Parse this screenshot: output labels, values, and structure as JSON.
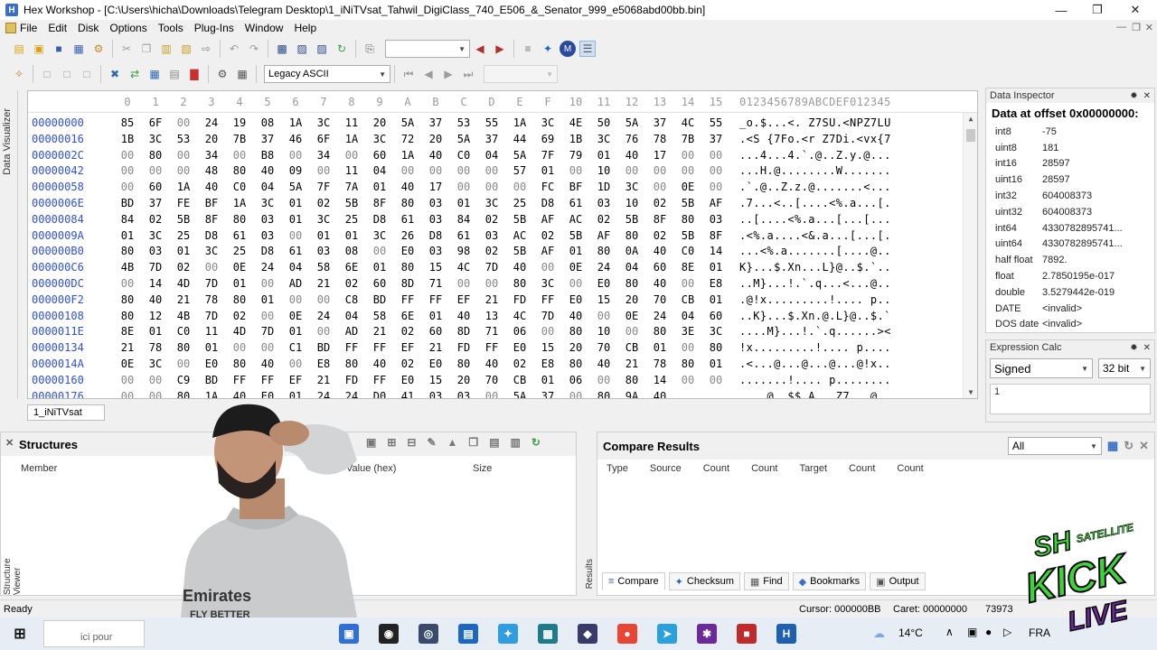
{
  "window": {
    "title": "Hex Workshop - [C:\\Users\\hicha\\Downloads\\Telegram Desktop\\1_iNiTVsat_Tahwil_DigiClass_740_E506_&_Senator_999_e5068abd00bb.bin]",
    "app_icon": "H"
  },
  "menu": [
    "File",
    "Edit",
    "Disk",
    "Options",
    "Tools",
    "Plug-Ins",
    "Window",
    "Help"
  ],
  "toolbar": {
    "encoding": "Legacy ASCII"
  },
  "editor": {
    "header_cols": [
      "0",
      "1",
      "2",
      "3",
      "4",
      "5",
      "6",
      "7",
      "8",
      "9",
      "A",
      "B",
      "C",
      "D",
      "E",
      "F",
      "10",
      "11",
      "12",
      "13",
      "14",
      "15"
    ],
    "ascii_header": "0123456789ABCDEF012345",
    "rows": [
      {
        "off": "00000000",
        "bytes": [
          "85",
          "6F",
          "00",
          "24",
          "19",
          "08",
          "1A",
          "3C",
          "11",
          "20",
          "5A",
          "37",
          "53",
          "55",
          "1A",
          "3C",
          "4E",
          "50",
          "5A",
          "37",
          "4C",
          "55"
        ],
        "ascii": "_o.$...<. Z7SU.<NPZ7LU"
      },
      {
        "off": "00000016",
        "bytes": [
          "1B",
          "3C",
          "53",
          "20",
          "7B",
          "37",
          "46",
          "6F",
          "1A",
          "3C",
          "72",
          "20",
          "5A",
          "37",
          "44",
          "69",
          "1B",
          "3C",
          "76",
          "78",
          "7B",
          "37"
        ],
        "ascii": ".<S {7Fo.<r Z7Di.<vx{7"
      },
      {
        "off": "0000002C",
        "bytes": [
          "00",
          "80",
          "00",
          "34",
          "00",
          "B8",
          "00",
          "34",
          "00",
          "60",
          "1A",
          "40",
          "C0",
          "04",
          "5A",
          "7F",
          "79",
          "01",
          "40",
          "17",
          "00",
          "00"
        ],
        "ascii": "...4...4.`.@..Z.y.@..."
      },
      {
        "off": "00000042",
        "bytes": [
          "00",
          "00",
          "00",
          "48",
          "80",
          "40",
          "09",
          "00",
          "11",
          "04",
          "00",
          "00",
          "00",
          "00",
          "57",
          "01",
          "00",
          "10",
          "00",
          "00",
          "00",
          "00"
        ],
        "ascii": "...H.@........W......."
      },
      {
        "off": "00000058",
        "bytes": [
          "00",
          "60",
          "1A",
          "40",
          "C0",
          "04",
          "5A",
          "7F",
          "7A",
          "01",
          "40",
          "17",
          "00",
          "00",
          "00",
          "FC",
          "BF",
          "1D",
          "3C",
          "00",
          "0E",
          "00"
        ],
        "ascii": ".`.@..Z.z.@.......<..."
      },
      {
        "off": "0000006E",
        "bytes": [
          "BD",
          "37",
          "FE",
          "BF",
          "1A",
          "3C",
          "01",
          "02",
          "5B",
          "8F",
          "80",
          "03",
          "01",
          "3C",
          "25",
          "D8",
          "61",
          "03",
          "10",
          "02",
          "5B",
          "AF"
        ],
        "ascii": ".7...<..[....<%.a...[."
      },
      {
        "off": "00000084",
        "bytes": [
          "84",
          "02",
          "5B",
          "8F",
          "80",
          "03",
          "01",
          "3C",
          "25",
          "D8",
          "61",
          "03",
          "84",
          "02",
          "5B",
          "AF",
          "AC",
          "02",
          "5B",
          "8F",
          "80",
          "03"
        ],
        "ascii": "..[....<%.a...[...[..."
      },
      {
        "off": "0000009A",
        "bytes": [
          "01",
          "3C",
          "25",
          "D8",
          "61",
          "03",
          "00",
          "01",
          "01",
          "3C",
          "26",
          "D8",
          "61",
          "03",
          "AC",
          "02",
          "5B",
          "AF",
          "80",
          "02",
          "5B",
          "8F"
        ],
        "ascii": ".<%.a....<&.a...[...[."
      },
      {
        "off": "000000B0",
        "bytes": [
          "80",
          "03",
          "01",
          "3C",
          "25",
          "D8",
          "61",
          "03",
          "08",
          "00",
          "E0",
          "03",
          "98",
          "02",
          "5B",
          "AF",
          "01",
          "80",
          "0A",
          "40",
          "C0",
          "14"
        ],
        "ascii": "...<%.a.......[....@.."
      },
      {
        "off": "000000C6",
        "bytes": [
          "4B",
          "7D",
          "02",
          "00",
          "0E",
          "24",
          "04",
          "58",
          "6E",
          "01",
          "80",
          "15",
          "4C",
          "7D",
          "40",
          "00",
          "0E",
          "24",
          "04",
          "60",
          "8E",
          "01"
        ],
        "ascii": "K}...$.Xn...L}@..$.`.."
      },
      {
        "off": "000000DC",
        "bytes": [
          "00",
          "14",
          "4D",
          "7D",
          "01",
          "00",
          "AD",
          "21",
          "02",
          "60",
          "8D",
          "71",
          "00",
          "00",
          "80",
          "3C",
          "00",
          "E0",
          "80",
          "40",
          "00",
          "E8"
        ],
        "ascii": "..M}...!.`.q...<...@.."
      },
      {
        "off": "000000F2",
        "bytes": [
          "80",
          "40",
          "21",
          "78",
          "80",
          "01",
          "00",
          "00",
          "C8",
          "BD",
          "FF",
          "FF",
          "EF",
          "21",
          "FD",
          "FF",
          "E0",
          "15",
          "20",
          "70",
          "CB",
          "01"
        ],
        "ascii": ".@!x.........!.... p.."
      },
      {
        "off": "00000108",
        "bytes": [
          "80",
          "12",
          "4B",
          "7D",
          "02",
          "00",
          "0E",
          "24",
          "04",
          "58",
          "6E",
          "01",
          "40",
          "13",
          "4C",
          "7D",
          "40",
          "00",
          "0E",
          "24",
          "04",
          "60"
        ],
        "ascii": "..K}...$.Xn.@.L}@..$.`"
      },
      {
        "off": "0000011E",
        "bytes": [
          "8E",
          "01",
          "C0",
          "11",
          "4D",
          "7D",
          "01",
          "00",
          "AD",
          "21",
          "02",
          "60",
          "8D",
          "71",
          "06",
          "00",
          "80",
          "10",
          "00",
          "80",
          "3E",
          "3C"
        ],
        "ascii": "....M}...!.`.q......><"
      },
      {
        "off": "00000134",
        "bytes": [
          "21",
          "78",
          "80",
          "01",
          "00",
          "00",
          "C1",
          "BD",
          "FF",
          "FF",
          "EF",
          "21",
          "FD",
          "FF",
          "E0",
          "15",
          "20",
          "70",
          "CB",
          "01",
          "00",
          "80"
        ],
        "ascii": "!x.........!.... p...."
      },
      {
        "off": "0000014A",
        "bytes": [
          "0E",
          "3C",
          "00",
          "E0",
          "80",
          "40",
          "00",
          "E8",
          "80",
          "40",
          "02",
          "E0",
          "80",
          "40",
          "02",
          "E8",
          "80",
          "40",
          "21",
          "78",
          "80",
          "01"
        ],
        "ascii": ".<...@...@...@...@!x.."
      },
      {
        "off": "00000160",
        "bytes": [
          "00",
          "00",
          "C9",
          "BD",
          "FF",
          "FF",
          "EF",
          "21",
          "FD",
          "FF",
          "E0",
          "15",
          "20",
          "70",
          "CB",
          "01",
          "06",
          "00",
          "80",
          "14",
          "00",
          "00"
        ],
        "ascii": ".......!.... p........"
      },
      {
        "off": "00000176",
        "bytes": [
          "00",
          "00",
          "80",
          "1A",
          "40",
          "E0",
          "01",
          "24",
          "24",
          "D0",
          "41",
          "03",
          "03",
          "00",
          "5A",
          "37",
          "00",
          "80",
          "9A",
          "40",
          "",
          ""
        ],
        "ascii": "....@..$$.A...Z7...@."
      }
    ]
  },
  "left_dock_label": "Data Visualizer",
  "file_tab": "1_iNiTVsat",
  "data_inspector": {
    "title": "Data Inspector",
    "offset_label": "Data at offset 0x00000000:",
    "items": [
      {
        "k": "int8",
        "v": "-75"
      },
      {
        "k": "uint8",
        "v": "181"
      },
      {
        "k": "int16",
        "v": "28597"
      },
      {
        "k": "uint16",
        "v": "28597"
      },
      {
        "k": "int32",
        "v": "604008373"
      },
      {
        "k": "uint32",
        "v": "604008373"
      },
      {
        "k": "int64",
        "v": "4330782895741..."
      },
      {
        "k": "uint64",
        "v": "4330782895741..."
      },
      {
        "k": "half float",
        "v": "7892."
      },
      {
        "k": "float",
        "v": "2.7850195e-017"
      },
      {
        "k": "double",
        "v": "3.5279442e-019"
      },
      {
        "k": "DATE",
        "v": "<invalid>"
      },
      {
        "k": "DOS date",
        "v": "<invalid>"
      }
    ]
  },
  "expression_calc": {
    "title": "Expression Calc",
    "sign": "Signed",
    "bits": "32 bit",
    "input": "1"
  },
  "structures": {
    "title": "Structures",
    "cols": [
      "Member",
      "(dec)",
      "Value (hex)",
      "Size"
    ],
    "side_label": "Structure Viewer"
  },
  "compare": {
    "title": "Compare Results",
    "filter": "All",
    "cols": [
      "Type",
      "Source",
      "Count",
      "Count",
      "Target",
      "Count",
      "Count"
    ],
    "side_label": "Results",
    "tabs": [
      "Compare",
      "Checksum",
      "Find",
      "Bookmarks",
      "Output"
    ]
  },
  "status": {
    "left": "Ready",
    "cursor": "Cursor: 000000BB",
    "caret": "Caret: 00000000",
    "size": "73973"
  },
  "taskbar": {
    "temp": "14°C",
    "lang": "FRA",
    "search_text": "ici pour"
  },
  "overlay": {
    "logo_text": [
      "SH",
      "SATELLITE",
      "KICK",
      "LIVE"
    ],
    "shirt_text": [
      "Emirates",
      "FLY BETTER"
    ]
  },
  "colors": {
    "offset_blue": "#3050d8",
    "header_gray": "#9a9a9a",
    "logo_green": "#3fd23a",
    "logo_purple": "#6b2a9a"
  }
}
